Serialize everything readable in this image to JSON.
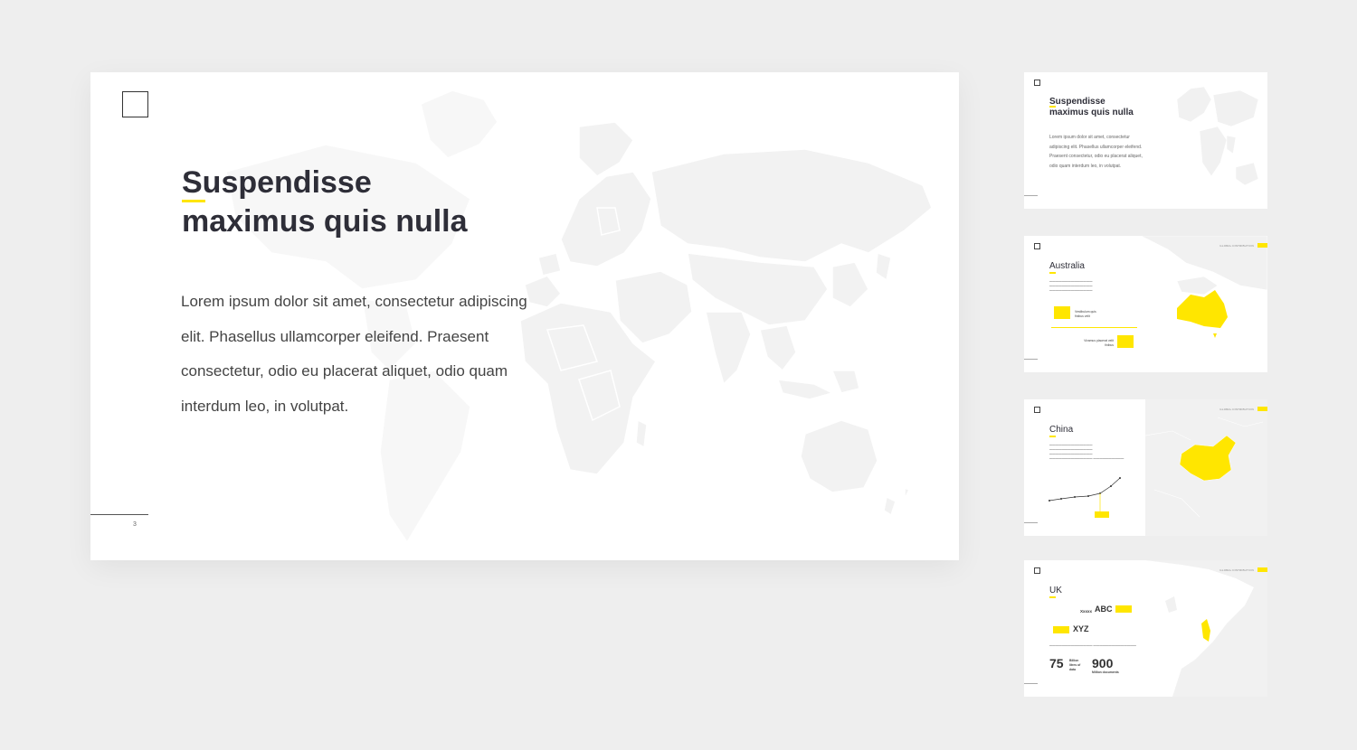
{
  "main_slide": {
    "title_line1": "Suspendisse",
    "title_line2": "maximus quis nulla",
    "body": "Lorem ipsum dolor sit amet, consectetur adipiscing elit. Phasellus ullamcorper eleifend. Praesent consectetur, odio eu placerat aliquet, odio quam interdum leo, in volutpat.",
    "page_number": "3"
  },
  "thumbnails": [
    {
      "title_line1": "Suspendisse",
      "title_line2": "maximus quis nulla",
      "body": "Lorem ipsum dolor sit amet, consectetur adipiscing elit. Phasellus ullamcorper eleifend. Praesent consectetur, odio eu placerat aliquet, odio quam interdum leo, in volutpat."
    },
    {
      "country": "Australia",
      "header_label": "GLOBAL DISTRIBUTION",
      "label_a": "Vestibulum quis finibus velit",
      "label_b": "Vivamus placerat velit finibus"
    },
    {
      "country": "China",
      "header_label": "GLOBAL DISTRIBUTION"
    },
    {
      "country": "UK",
      "header_label": "GLOBAL DISTRIBUTION",
      "abc": "ABC",
      "xyz": "XYZ",
      "code": "Xxxxx",
      "stat1_value": "75",
      "stat1_label": "Billion litres of data",
      "stat2_value": "900",
      "stat2_label": "Million documents"
    }
  ],
  "colors": {
    "accent": "#ffe600",
    "map": "#f1f1f1",
    "text": "#2e2e38",
    "background": "#eeeeee"
  },
  "icons": {
    "logo": "square-logo-icon"
  }
}
